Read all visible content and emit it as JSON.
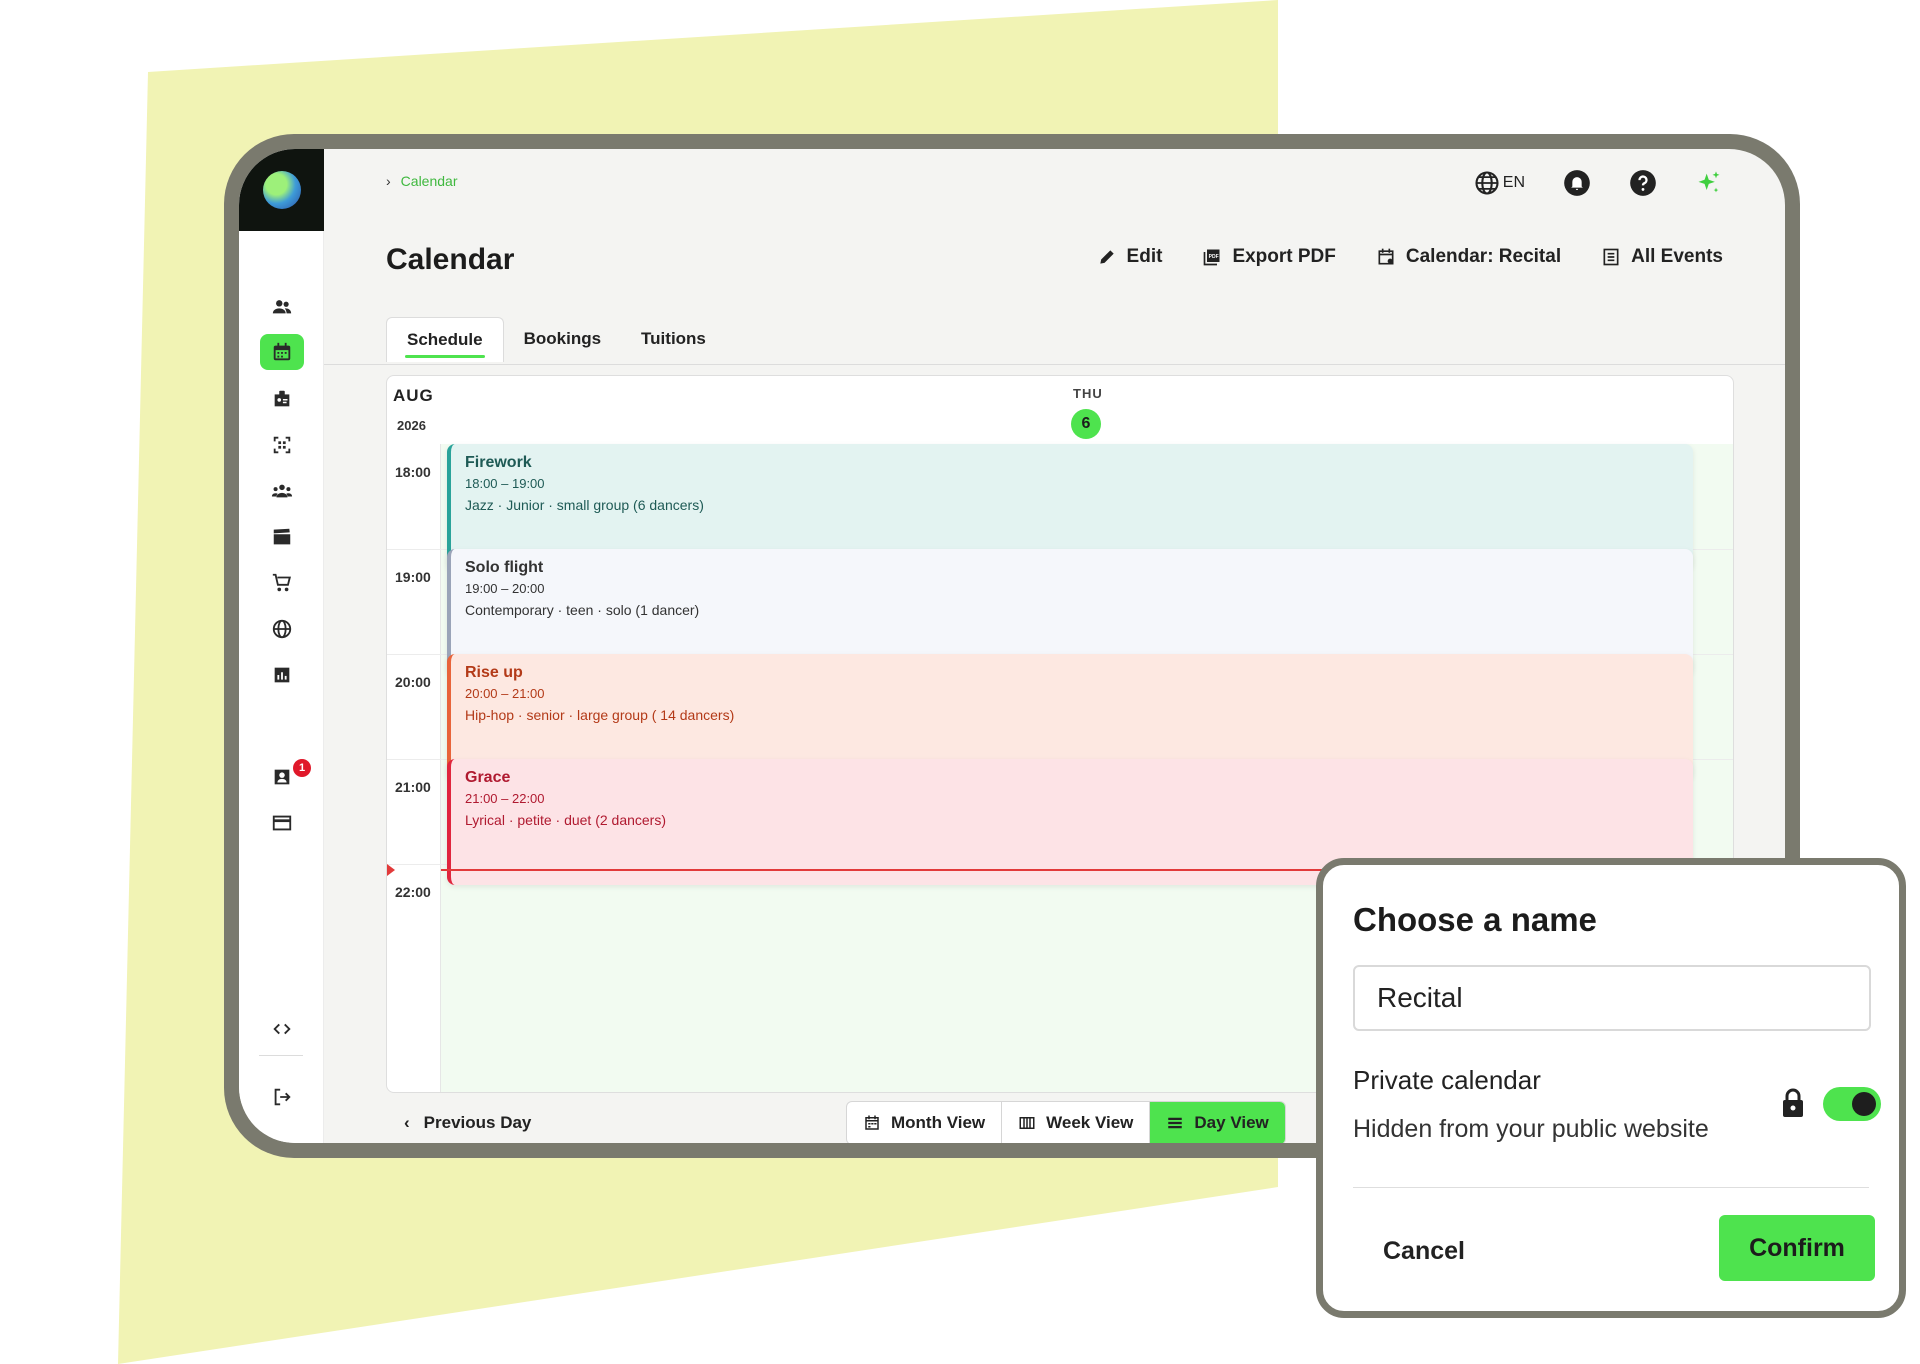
{
  "breadcrumb": {
    "current": "Calendar"
  },
  "header": {
    "language": "EN"
  },
  "page": {
    "title": "Calendar"
  },
  "actions": {
    "edit": "Edit",
    "export_pdf": "Export PDF",
    "calendar": "Calendar: Recital",
    "all_events": "All Events"
  },
  "tabs": [
    {
      "label": "Schedule",
      "active": true
    },
    {
      "label": "Bookings",
      "active": false
    },
    {
      "label": "Tuitions",
      "active": false
    }
  ],
  "calendar": {
    "month": "AUG",
    "year": "2026",
    "day_name": "THU",
    "day_number": "6",
    "hours": [
      "18:00",
      "19:00",
      "20:00",
      "21:00",
      "22:00"
    ],
    "events": [
      {
        "title": "Firework",
        "time": "18:00 – 19:00",
        "desc": "Jazz · Junior · small group (6 dancers)",
        "color": "#e3f3f1",
        "border": "#2aa39a",
        "text": "#1e5a55"
      },
      {
        "title": "Solo flight",
        "time": "19:00 – 20:00",
        "desc": "Contemporary · teen · solo (1 dancer)",
        "color": "#f5f7fb",
        "border": "#9aa4b8",
        "text": "#333333"
      },
      {
        "title": "Rise up",
        "time": "20:00 – 21:00",
        "desc": "Hip-hop · senior · large group ( 14 dancers)",
        "color": "#fde8e1",
        "border": "#e8643a",
        "text": "#b33a18"
      },
      {
        "title": "Grace",
        "time": "21:00 – 22:00",
        "desc": "Lyrical · petite · duet (2 dancers)",
        "color": "#fde3e6",
        "border": "#e0263e",
        "text": "#b01a30"
      }
    ]
  },
  "footer": {
    "previous_day": "Previous Day",
    "month_view": "Month View",
    "week_view": "Week View",
    "day_view": "Day View"
  },
  "sidebar": {
    "badge_count": "1"
  },
  "dialog": {
    "title": "Choose a name",
    "input_value": "Recital",
    "private_label": "Private calendar",
    "private_hint": "Hidden from your public website",
    "private_enabled": true,
    "cancel": "Cancel",
    "confirm": "Confirm"
  },
  "colors": {
    "accent": "#4ee34e",
    "background_shape": "#f1f3b4",
    "frame": "#7a7a6e"
  }
}
